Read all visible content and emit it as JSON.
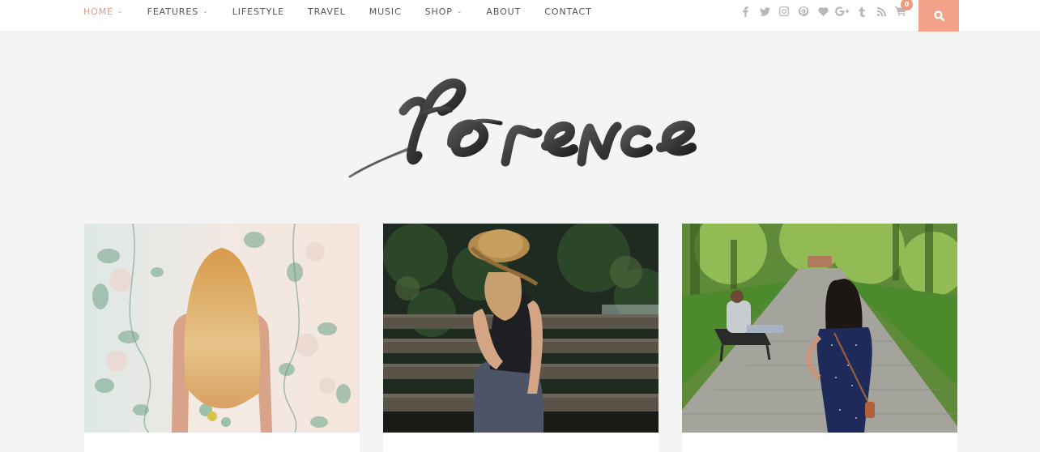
{
  "nav": {
    "items": [
      {
        "label": "Home",
        "dropdown": true,
        "active": true
      },
      {
        "label": "Features",
        "dropdown": true,
        "active": false
      },
      {
        "label": "Lifestyle",
        "dropdown": false,
        "active": false
      },
      {
        "label": "Travel",
        "dropdown": false,
        "active": false
      },
      {
        "label": "Music",
        "dropdown": false,
        "active": false
      },
      {
        "label": "Shop",
        "dropdown": true,
        "active": false
      },
      {
        "label": "About",
        "dropdown": false,
        "active": false
      },
      {
        "label": "Contact",
        "dropdown": false,
        "active": false
      }
    ],
    "chevron": "⌄"
  },
  "social": [
    "facebook-icon",
    "twitter-icon",
    "instagram-icon",
    "pinterest-icon",
    "bloglovin-heart-icon",
    "google-plus-icon",
    "tumblr-icon",
    "rss-icon"
  ],
  "cart": {
    "count": "0"
  },
  "search": {
    "icon": "search-icon"
  },
  "logo": {
    "text": "florence"
  },
  "colors": {
    "accent": "#f2a28a",
    "badge": "#ec9b83",
    "nav_text": "#555555",
    "icon": "#b8b8b8",
    "background": "#f4f4f4"
  },
  "posts": [
    {
      "image": "woman with long blonde hair facing floral wallpaper"
    },
    {
      "image": "woman in straw hat sitting on wooden park bench"
    },
    {
      "image": "woman in polka dot dress walking on park path"
    }
  ]
}
